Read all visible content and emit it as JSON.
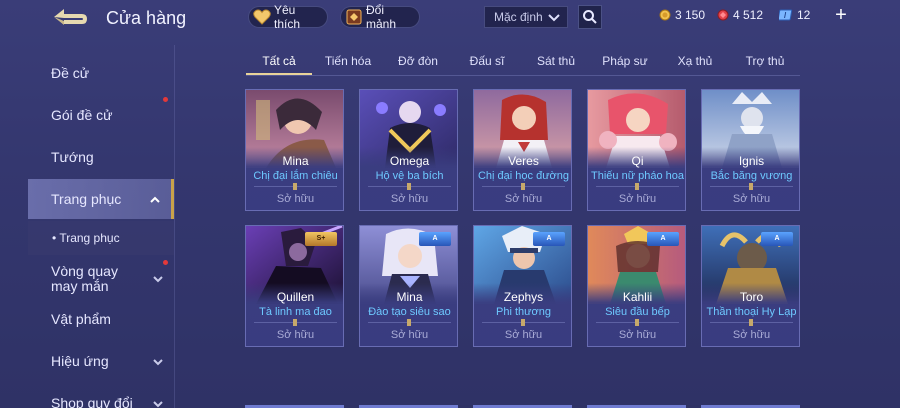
{
  "header": {
    "title": "Cửa hàng",
    "favorites_label": "Yêu thích",
    "trade_label": "Đổi mảnh",
    "sort_value": "Mặc định",
    "gold": "3 150",
    "ruby": "4 512",
    "voucher": "12",
    "plus": "+"
  },
  "sidebar": {
    "items": [
      {
        "label": "Đề cử"
      },
      {
        "label": "Gói đề cử"
      },
      {
        "label": "Tướng"
      },
      {
        "label": "Trang phục"
      },
      {
        "label": "• Trang phục"
      },
      {
        "label": "Vòng quay may mắn"
      },
      {
        "label": "Vật phẩm"
      },
      {
        "label": "Hiệu ứng"
      },
      {
        "label": "Shop quy đổi"
      }
    ]
  },
  "tabs": [
    {
      "label": "Tất cả"
    },
    {
      "label": "Tiến hóa"
    },
    {
      "label": "Đỡ đòn"
    },
    {
      "label": "Đấu sĩ"
    },
    {
      "label": "Sát thủ"
    },
    {
      "label": "Pháp sư"
    },
    {
      "label": "Xạ thủ"
    },
    {
      "label": "Trợ thủ"
    }
  ],
  "cards": [
    {
      "hero": "Mina",
      "skin": "Chị đại lắm chiêu",
      "status": "Sở hữu",
      "badge": ""
    },
    {
      "hero": "Omega",
      "skin": "Hộ vệ ba bích",
      "status": "Sở hữu",
      "badge": ""
    },
    {
      "hero": "Veres",
      "skin": "Chị đại học đường",
      "status": "Sở hữu",
      "badge": ""
    },
    {
      "hero": "Qi",
      "skin": "Thiếu nữ pháo hoa",
      "status": "Sở hữu",
      "badge": ""
    },
    {
      "hero": "Ignis",
      "skin": "Bắc băng vương",
      "status": "Sở hữu",
      "badge": ""
    },
    {
      "hero": "Quillen",
      "skin": "Tà linh ma đao",
      "status": "Sở hữu",
      "badge": "S+"
    },
    {
      "hero": "Mina",
      "skin": "Đào tạo siêu sao",
      "status": "Sở hữu",
      "badge": "A"
    },
    {
      "hero": "Zephys",
      "skin": "Phi thương",
      "status": "Sở hữu",
      "badge": "A"
    },
    {
      "hero": "Kahlii",
      "skin": "Siêu đầu bếp",
      "status": "Sở hữu",
      "badge": "A"
    },
    {
      "hero": "Toro",
      "skin": "Thần thoại Hy Lạp",
      "status": "Sở hữu",
      "badge": "A"
    }
  ],
  "colors": {
    "accent_gold": "#e8d39a",
    "skin_name": "#6ec9ff",
    "notification_dot": "#e2393a"
  },
  "icons": [
    "back-arrow-icon",
    "heart-icon",
    "trade-icon",
    "chevron-down-icon",
    "search-icon",
    "gold-coin-icon",
    "ruby-icon",
    "voucher-icon",
    "plus-icon"
  ]
}
